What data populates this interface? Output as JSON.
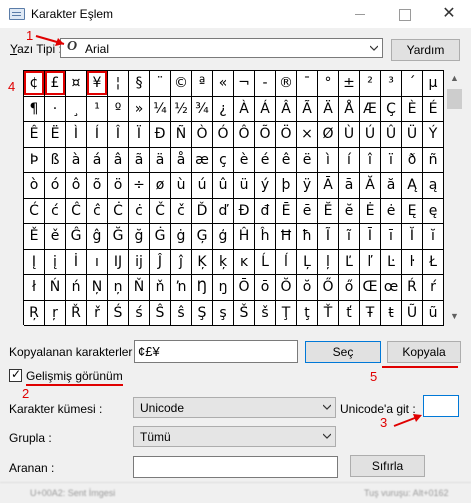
{
  "window": {
    "title": "Karakter Eşlem"
  },
  "font_row": {
    "label": "Yazı Tipi :",
    "selected_font": "Arial",
    "font_icon_glyph": "O",
    "help_button": "Yardım"
  },
  "char_grid": {
    "rows": [
      [
        "¢",
        "£",
        "¤",
        "¥",
        "¦",
        "§",
        "¨",
        "©",
        "ª",
        "«",
        "¬",
        "-",
        "®",
        "¯",
        "°",
        "±",
        "²",
        "³",
        "´",
        "µ"
      ],
      [
        "¶",
        "·",
        "¸",
        "¹",
        "º",
        "»",
        "¼",
        "½",
        "¾",
        "¿",
        "À",
        "Á",
        "Â",
        "Ã",
        "Ä",
        "Å",
        "Æ",
        "Ç",
        "È",
        "É"
      ],
      [
        "Ê",
        "Ë",
        "Ì",
        "Í",
        "Î",
        "Ï",
        "Ð",
        "Ñ",
        "Ò",
        "Ó",
        "Ô",
        "Õ",
        "Ö",
        "×",
        "Ø",
        "Ù",
        "Ú",
        "Û",
        "Ü",
        "Ý"
      ],
      [
        "Þ",
        "ß",
        "à",
        "á",
        "â",
        "ã",
        "ä",
        "å",
        "æ",
        "ç",
        "è",
        "é",
        "ê",
        "ë",
        "ì",
        "í",
        "î",
        "ï",
        "ð",
        "ñ"
      ],
      [
        "ò",
        "ó",
        "ô",
        "õ",
        "ö",
        "÷",
        "ø",
        "ù",
        "ú",
        "û",
        "ü",
        "ý",
        "þ",
        "ÿ",
        "Ā",
        "ā",
        "Ă",
        "ă",
        "Ą",
        "ą"
      ],
      [
        "Ć",
        "ć",
        "Ĉ",
        "ĉ",
        "Ċ",
        "ċ",
        "Č",
        "č",
        "Ď",
        "ď",
        "Đ",
        "đ",
        "Ē",
        "ē",
        "Ĕ",
        "ĕ",
        "Ė",
        "ė",
        "Ę",
        "ę"
      ],
      [
        "Ě",
        "ě",
        "Ĝ",
        "ĝ",
        "Ğ",
        "ğ",
        "Ġ",
        "ġ",
        "Ģ",
        "ģ",
        "Ĥ",
        "ĥ",
        "Ħ",
        "ħ",
        "Ĩ",
        "ĩ",
        "Ī",
        "ī",
        "Ĭ",
        "ĭ"
      ],
      [
        "Į",
        "į",
        "İ",
        "ı",
        "Ĳ",
        "ĳ",
        "Ĵ",
        "ĵ",
        "Ķ",
        "ķ",
        "ĸ",
        "Ĺ",
        "ĺ",
        "Ļ",
        "ļ",
        "Ľ",
        "ľ",
        "Ŀ",
        "ŀ",
        "Ł"
      ],
      [
        "ł",
        "Ń",
        "ń",
        "Ņ",
        "ņ",
        "Ň",
        "ň",
        "ŉ",
        "Ŋ",
        "ŋ",
        "Ō",
        "ō",
        "Ŏ",
        "ŏ",
        "Ő",
        "ő",
        "Œ",
        "œ",
        "Ŕ",
        "ŕ"
      ],
      [
        "Ŗ",
        "ŗ",
        "Ř",
        "ř",
        "Ś",
        "ś",
        "Ŝ",
        "ŝ",
        "Ş",
        "ş",
        "Š",
        "š",
        "Ţ",
        "ţ",
        "Ť",
        "ť",
        "Ŧ",
        "ŧ",
        "Ũ",
        "ũ"
      ]
    ]
  },
  "copy_row": {
    "label": "Kopyalanan karakterler :",
    "value": "¢£¥",
    "select_button": "Seç",
    "copy_button": "Kopyala"
  },
  "advanced": {
    "checkbox_label": "Gelişmiş görünüm",
    "checked": true
  },
  "options": {
    "charset_label": "Karakter kümesi :",
    "charset_value": "Unicode",
    "group_label": "Grupla :",
    "group_value": "Tümü",
    "goto_label": "Unicode'a git :",
    "goto_value": "",
    "search_label": "Aranan :",
    "search_value": "",
    "search_button": "Sıfırla"
  },
  "status": {
    "left": "U+00A2: Sent İmgesi",
    "right": "Tuş vuruşu: Alt+0162"
  },
  "annotations": [
    "1",
    "2",
    "3",
    "4",
    "5"
  ],
  "colors": {
    "annotation_red": "#e00000",
    "focus_blue": "#0078d7"
  }
}
